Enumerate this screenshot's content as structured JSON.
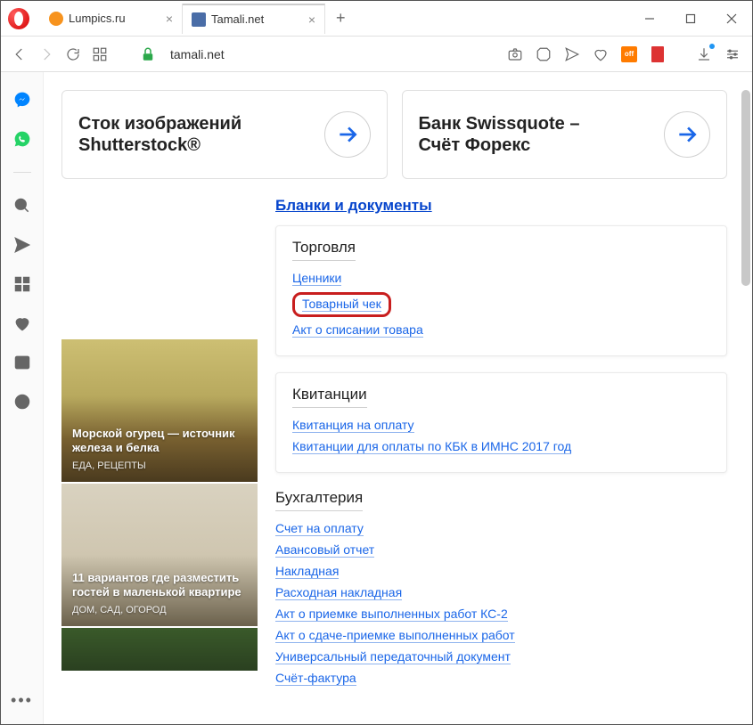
{
  "tabs": [
    {
      "title": "Lumpics.ru",
      "favColor": "#f7931e",
      "active": false
    },
    {
      "title": "Tamali.net",
      "favColor": "#4a6da7",
      "active": true
    }
  ],
  "address": {
    "url": "tamali.net"
  },
  "ads": [
    {
      "line1": "Сток изображений",
      "line2": "Shutterstock®"
    },
    {
      "line1": "Банк Swissquote –",
      "line2": "Счёт Форекс"
    }
  ],
  "feed": [
    {
      "title": "Морской огурец — источник железа и белка",
      "category": "ЕДА, РЕЦЕПТЫ"
    },
    {
      "title": "11 вариантов где разместить гостей в маленькой квартире",
      "category": "ДОМ, САД, ОГОРОД"
    }
  ],
  "docs": {
    "header": "Бланки и документы",
    "section1": {
      "title": "Торговля",
      "links": [
        "Ценники",
        "Товарный чек",
        "Акт о списании товара"
      ],
      "highlightIndex": 1
    },
    "section2": {
      "title": "Квитанции",
      "links": [
        "Квитанция на оплату",
        "Квитанции для оплаты по КБК в ИМНС 2017 год"
      ]
    },
    "section3": {
      "title": "Бухгалтерия",
      "links": [
        "Счет на оплату",
        "Авансовый отчет",
        "Накладная",
        "Расходная накладная",
        "Акт о приемке выполненных работ КС-2",
        "Акт о сдаче-приемке выполненных работ",
        "Универсальный передаточный документ",
        "Счёт-фактура"
      ]
    }
  }
}
